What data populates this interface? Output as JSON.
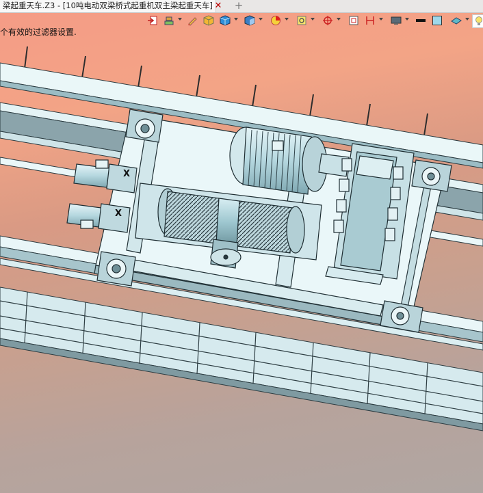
{
  "window": {
    "tab_title": "梁起重天车.Z3 - [10吨电动双梁桥式起重机双主梁起重天车]",
    "close_glyph": "✕",
    "add_glyph": "+"
  },
  "status_message": "个有效的过滤器设置.",
  "model_label": "X",
  "toolbar": {
    "items": [
      {
        "icon": "exit-sketch-icon",
        "dropdown": false
      },
      {
        "icon": "layer-color-icon",
        "dropdown": true
      },
      {
        "icon": "pencil-icon",
        "dropdown": false
      },
      {
        "icon": "shaded-cube-icon",
        "dropdown": false
      },
      {
        "icon": "blue-cube-icon",
        "dropdown": true
      },
      {
        "icon": "view-cube-icon",
        "dropdown": true
      },
      {
        "icon": "section-pie-icon",
        "dropdown": true
      },
      {
        "icon": "zoom-fit-icon",
        "dropdown": true
      },
      {
        "icon": "target-icon",
        "dropdown": true
      },
      {
        "icon": "frame-icon",
        "dropdown": false
      },
      {
        "icon": "dimension-icon",
        "dropdown": true
      },
      {
        "icon": "display-icon",
        "dropdown": true
      },
      {
        "icon": "line-color-icon",
        "dropdown": false
      },
      {
        "icon": "fill-color-icon",
        "dropdown": false
      },
      {
        "icon": "plane-icon",
        "dropdown": true
      },
      {
        "icon": "lightbulb-icon",
        "dropdown": false
      }
    ],
    "colors": {
      "line_color": "#111111",
      "fill_color": "#9fd8ea",
      "accent": "#e0201c"
    }
  }
}
